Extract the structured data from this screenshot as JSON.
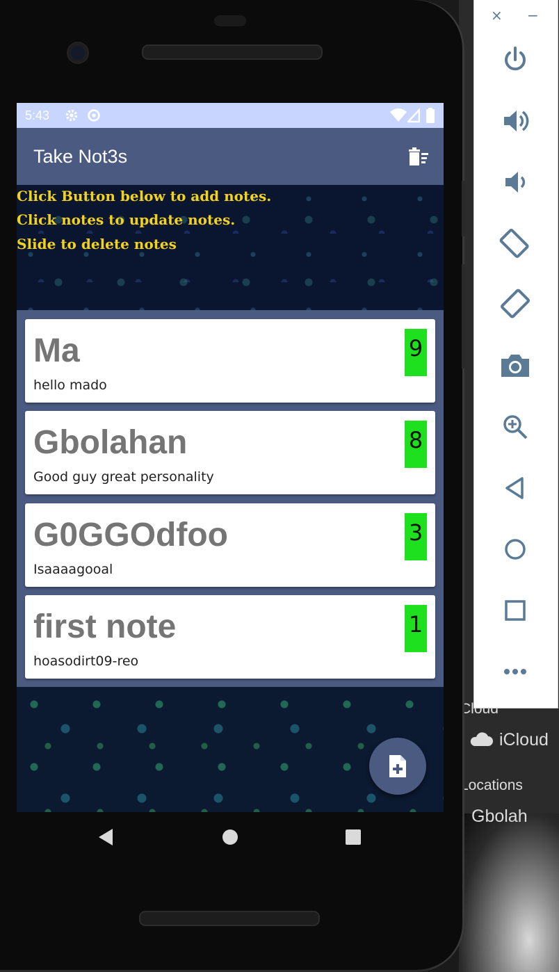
{
  "desktop": {
    "finder_cloud_label": "Cloud",
    "finder_icloud_label": "iCloud",
    "finder_locations_label": "Locations",
    "finder_item_partial": "Gbolah"
  },
  "status_bar": {
    "time": "5:43"
  },
  "app_bar": {
    "title": "Take Not3s",
    "delete_all_icon": "delete-sweep-icon"
  },
  "banner": {
    "lines": [
      "Click Button below to add notes.",
      "Click notes to update notes.",
      "Slide to delete notes"
    ]
  },
  "notes": [
    {
      "title": "Ma",
      "description": "hello mado",
      "priority": "9"
    },
    {
      "title": "Gbolahan",
      "description": "Good guy great personality",
      "priority": "8"
    },
    {
      "title": "G0GGOdfoo",
      "description": "Isaaaagooal",
      "priority": "3"
    },
    {
      "title": "first note",
      "description": "hoasodirt09-reo",
      "priority": "1"
    }
  ],
  "fab": {
    "icon": "note-add-icon"
  },
  "nav_bar": {
    "back": "back-icon",
    "home": "home-icon",
    "recents": "recents-icon"
  },
  "emulator_toolbar": {
    "close": "×",
    "minimize": "−",
    "buttons": [
      "power-icon",
      "volume-up-icon",
      "volume-down-icon",
      "rotate-left-icon",
      "rotate-right-icon",
      "screenshot-icon",
      "zoom-icon",
      "back-icon",
      "home-icon",
      "overview-icon",
      "more-icon"
    ]
  },
  "colors": {
    "app_bar": "#4a5a80",
    "status_bar": "#c8d6ff",
    "banner_text": "#f2d21c",
    "priority_badge": "#1fe01f",
    "emulator_icon": "#5a7a96"
  }
}
